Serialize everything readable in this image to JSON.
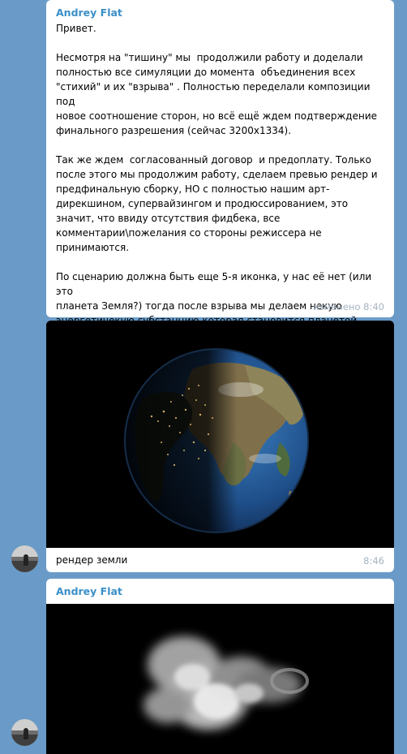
{
  "messages": [
    {
      "sender": "Andrey Flat",
      "text": "Привет.\n\nНесмотря на \"тишину\" мы  продолжили работу и доделали\nполностью все симуляции до момента  объединения всех\n\"стихий\" и их \"взрыва\" . Полностью переделали композиции под\nновое соотношение сторон, но всё ещё ждем подтверждение\nфинального разрешения (сейчас 3200x1334).\n\nТак же ждем  согласованный договор  и предоплату. Только\nпосле этого мы продолжим работу, сделаем превью рендер и\nпредфинальную сборку, НО с полностью нашим арт-\ndирекшином, супервайзингом и продюссированием, это\nзначит, что ввиду отсутствия фидбека, все\nкомментарии\\пожелания со стороны режиссера не\nпринимаются.\n\nПо сценарию должна быть еще 5-я иконка, у нас её нет (или это\nпланета Земля?) тогда после взрыва мы делаем некую\nэнергетичекую субстанцию которая station a planet\n",
      "meta": "изменено 8:40"
    },
    {
      "caption": "рендер земли",
      "time": "8:46"
    },
    {
      "sender": "Andrey Flat"
    }
  ]
}
